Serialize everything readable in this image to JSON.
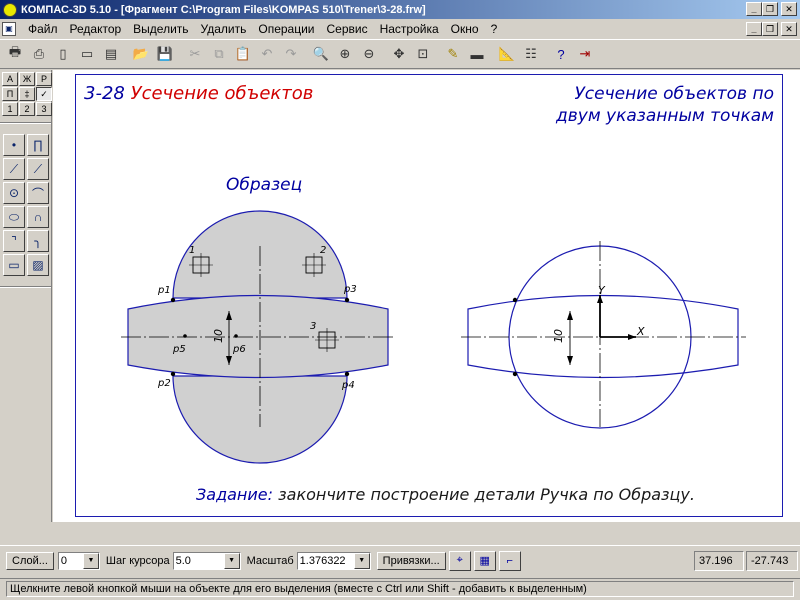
{
  "window": {
    "title": "КОМПАС-3D 5.10 - [Фрагмент C:\\Program Files\\KOMPAS 510\\Trener\\3-28.frw]"
  },
  "menu": {
    "items": [
      "Файл",
      "Редактор",
      "Выделить",
      "Удалить",
      "Операции",
      "Сервис",
      "Настройка",
      "Окно",
      "?"
    ]
  },
  "toolbar": {
    "icons": [
      "preview-icon",
      "print-icon",
      "new-icon",
      "new-sheet-icon",
      "new-book-icon",
      "open-icon",
      "save-icon",
      "cut-icon",
      "copy-icon",
      "paste-icon",
      "undo-icon",
      "redo-icon",
      "zoom-icon",
      "zoom-in-icon",
      "zoom-out-icon",
      "pan-icon",
      "zoom-all-icon",
      "refresh-icon",
      "properties-icon",
      "measure-icon",
      "library-icon",
      "help-icon",
      "exit-icon"
    ]
  },
  "leftpanel": {
    "top_buttons": [
      "А",
      "Ж",
      "Р",
      "П",
      "‡",
      "✓",
      "1",
      "2",
      "3"
    ],
    "tool_icons": [
      "point-icon",
      "parallel-lines-icon",
      "segment-icon",
      "polyline-icon",
      "circle-icon",
      "arc-icon",
      "ellipse-icon",
      "bezier-icon",
      "chamfer-icon",
      "fillet-icon",
      "rectangle-icon",
      "hatch-icon"
    ]
  },
  "drawing": {
    "number": "3-28",
    "name": "Усечение объектов",
    "desc_line1": "Усечение объектов по",
    "desc_line2": "двум указанным точкам",
    "sample_label": "Образец",
    "task_label": "Задание:",
    "task_text": "закончите построение детали Ручка по Образцу.",
    "labels": {
      "n1": "1",
      "n2": "2",
      "n3": "3",
      "p1": "p1",
      "p2": "p2",
      "p3": "p3",
      "p4": "p4",
      "p5": "p5",
      "p6": "p6",
      "dim_left": "10",
      "dim_right": "10",
      "axis_x": "X",
      "axis_y": "Y"
    },
    "colors": {
      "blue_line": "#1c1cb0",
      "fill": "#d0d0d0",
      "title_red": "#d00000",
      "text_blue": "#0000a0"
    }
  },
  "status": {
    "layer_button": "Слой...",
    "layer_value": "0",
    "step_label": "Шаг курсора",
    "step_value": "5.0",
    "scale_label": "Масштаб",
    "scale_value": "1.376322",
    "snap_button": "Привязки...",
    "coord_x": "37.196",
    "coord_y": "-27.743",
    "message": "Щелкните левой кнопкой мыши на объекте для его выделения (вместе с Ctrl или Shift - добавить к выделенным)"
  }
}
